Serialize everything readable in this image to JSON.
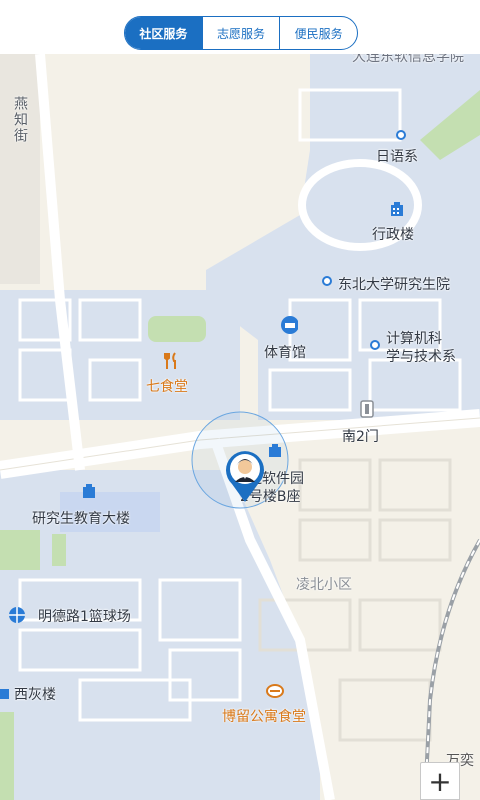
{
  "tabs": [
    {
      "label": "社区服务",
      "active": true
    },
    {
      "label": "志愿服务",
      "active": false
    },
    {
      "label": "便民服务",
      "active": false
    }
  ],
  "map": {
    "labels": {
      "top_cut": "大连东软信息学院",
      "yanzhi": "燕知街",
      "riyu": "日语系",
      "xingzheng": "行政楼",
      "yanjiusheng": "东北大学研究生院",
      "tiyuguan": "体育馆",
      "jisuanji_1": "计算机科",
      "jisuanji_2": "学与技术系",
      "qishitang": "七食堂",
      "nan2men": "南2门",
      "ruanjian_1": "大连软件园",
      "ruanjian_2": "2号楼B座",
      "yjs_jiaoyu": "研究生教育大楼",
      "lingbei": "凌北小区",
      "mingde": "明德路1篮球场",
      "xihui": "西灰楼",
      "boliu": "博留公寓食堂",
      "wanke": "万奕"
    },
    "zoom_in_label": "+",
    "colors": {
      "campus": "#d8e1ee",
      "ground": "#f4f1e8",
      "road": "#ffffff",
      "green": "#c4dfb1",
      "accent": "#1b6fc2",
      "orange": "#d9791a"
    }
  }
}
